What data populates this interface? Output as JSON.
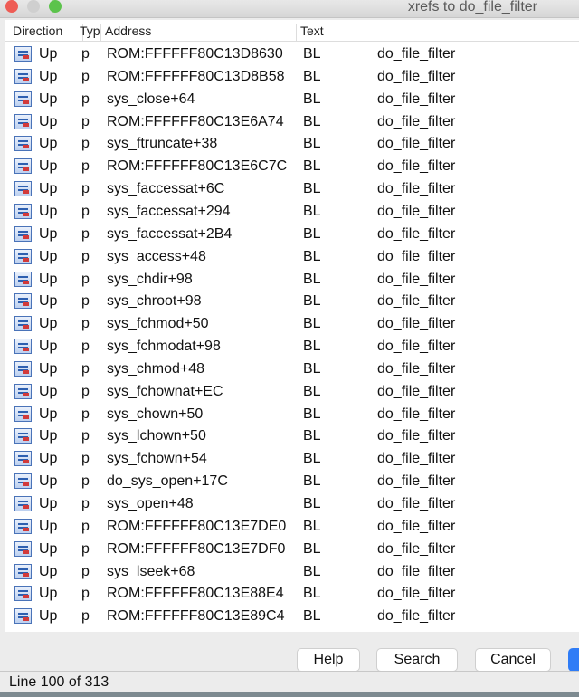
{
  "window": {
    "title": "xrefs to do_file_filter"
  },
  "columns": [
    "Direction",
    "Typ",
    "Address",
    "Text"
  ],
  "rows": [
    [
      "Up",
      "p",
      "ROM:FFFFFF80C13D8630",
      "BL",
      "do_file_filter"
    ],
    [
      "Up",
      "p",
      "ROM:FFFFFF80C13D8B58",
      "BL",
      "do_file_filter"
    ],
    [
      "Up",
      "p",
      "sys_close+64",
      "BL",
      "do_file_filter"
    ],
    [
      "Up",
      "p",
      "ROM:FFFFFF80C13E6A74",
      "BL",
      "do_file_filter"
    ],
    [
      "Up",
      "p",
      "sys_ftruncate+38",
      "BL",
      "do_file_filter"
    ],
    [
      "Up",
      "p",
      "ROM:FFFFFF80C13E6C7C",
      "BL",
      "do_file_filter"
    ],
    [
      "Up",
      "p",
      "sys_faccessat+6C",
      "BL",
      "do_file_filter"
    ],
    [
      "Up",
      "p",
      "sys_faccessat+294",
      "BL",
      "do_file_filter"
    ],
    [
      "Up",
      "p",
      "sys_faccessat+2B4",
      "BL",
      "do_file_filter"
    ],
    [
      "Up",
      "p",
      "sys_access+48",
      "BL",
      "do_file_filter"
    ],
    [
      "Up",
      "p",
      "sys_chdir+98",
      "BL",
      "do_file_filter"
    ],
    [
      "Up",
      "p",
      "sys_chroot+98",
      "BL",
      "do_file_filter"
    ],
    [
      "Up",
      "p",
      "sys_fchmod+50",
      "BL",
      "do_file_filter"
    ],
    [
      "Up",
      "p",
      "sys_fchmodat+98",
      "BL",
      "do_file_filter"
    ],
    [
      "Up",
      "p",
      "sys_chmod+48",
      "BL",
      "do_file_filter"
    ],
    [
      "Up",
      "p",
      "sys_fchownat+EC",
      "BL",
      "do_file_filter"
    ],
    [
      "Up",
      "p",
      "sys_chown+50",
      "BL",
      "do_file_filter"
    ],
    [
      "Up",
      "p",
      "sys_lchown+50",
      "BL",
      "do_file_filter"
    ],
    [
      "Up",
      "p",
      "sys_fchown+54",
      "BL",
      "do_file_filter"
    ],
    [
      "Up",
      "p",
      "do_sys_open+17C",
      "BL",
      "do_file_filter"
    ],
    [
      "Up",
      "p",
      "sys_open+48",
      "BL",
      "do_file_filter"
    ],
    [
      "Up",
      "p",
      "ROM:FFFFFF80C13E7DE0",
      "BL",
      "do_file_filter"
    ],
    [
      "Up",
      "p",
      "ROM:FFFFFF80C13E7DF0",
      "BL",
      "do_file_filter"
    ],
    [
      "Up",
      "p",
      "sys_lseek+68",
      "BL",
      "do_file_filter"
    ],
    [
      "Up",
      "p",
      "ROM:FFFFFF80C13E88E4",
      "BL",
      "do_file_filter"
    ],
    [
      "Up",
      "p",
      "ROM:FFFFFF80C13E89C4",
      "BL",
      "do_file_filter"
    ]
  ],
  "row_icon": "xref-icon",
  "buttons": {
    "help": "Help",
    "search": "Search",
    "cancel": "Cancel"
  },
  "status": "Line 100 of 313",
  "colors": {
    "close": "#ee5c55",
    "minimize": "#c9c9c9",
    "zoom": "#5cc34c",
    "ok_button": "#2f7cf6"
  }
}
